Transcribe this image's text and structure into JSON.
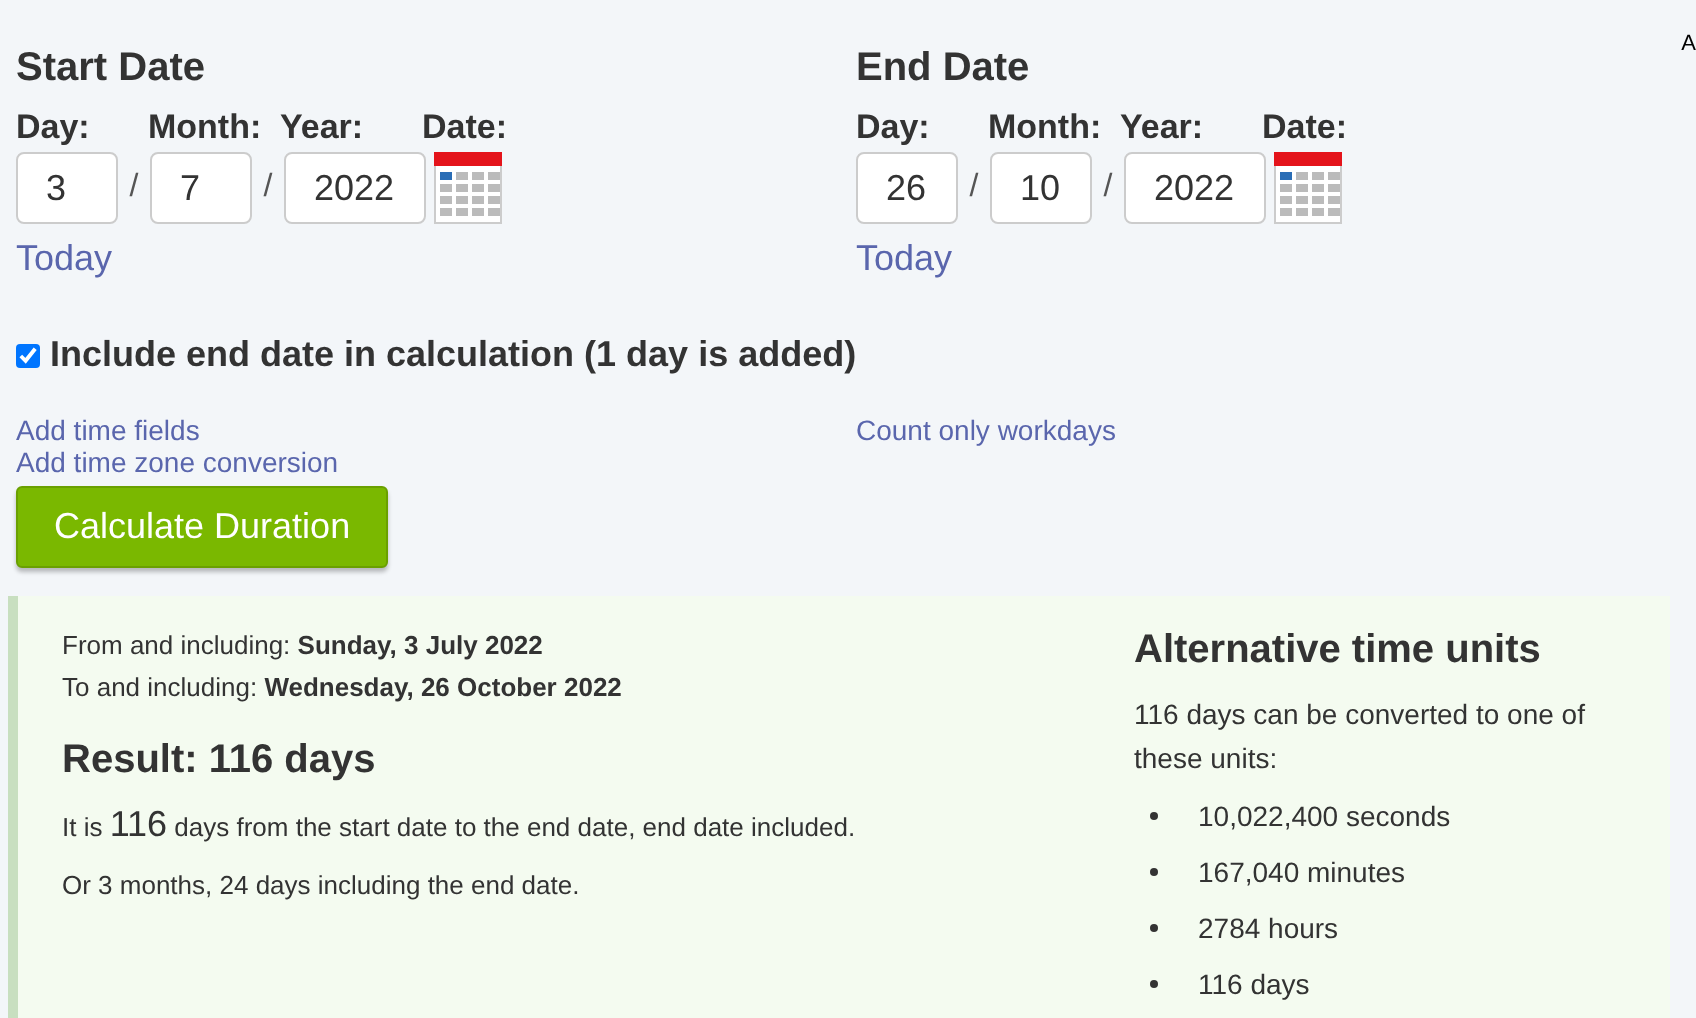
{
  "edge_text": "A",
  "dates": [
    {
      "title": "Start Date",
      "labels": [
        "Day:",
        "Month:",
        "Year:",
        "Date:"
      ],
      "day": "3",
      "month": "7",
      "year": "2022",
      "separators": [
        "/",
        "/"
      ],
      "today": "Today"
    },
    {
      "title": "End Date",
      "labels": [
        "Day:",
        "Month:",
        "Year:",
        "Date:"
      ],
      "day": "26",
      "month": "10",
      "year": "2022",
      "separators": [
        "/",
        "/"
      ],
      "today": "Today"
    }
  ],
  "include_end_date": {
    "label": "Include end date in calculation (1 day is added)",
    "checked": true
  },
  "links_left": [
    "Add time fields",
    "Add time zone conversion"
  ],
  "links_right": [
    "Count only workdays"
  ],
  "calculate_button": "Calculate Duration",
  "result": {
    "from": "From and including: **Sunday, 3 July 2022**",
    "to": "To and including: **Wednesday, 26 October 2022**",
    "heading": "Result: 116 days",
    "sentence": {
      "before": "It is ",
      "number": "116",
      "after": " days from the start date to the end date, end date included."
    },
    "alternative": "Or 3 months, 24 days including the end date."
  },
  "units": {
    "heading": "Alternative time units",
    "intro": "116 days can be converted to one of these units:",
    "items": [
      "10,022,400 seconds",
      "167,040 minutes",
      "2784 hours",
      "116 days"
    ]
  }
}
